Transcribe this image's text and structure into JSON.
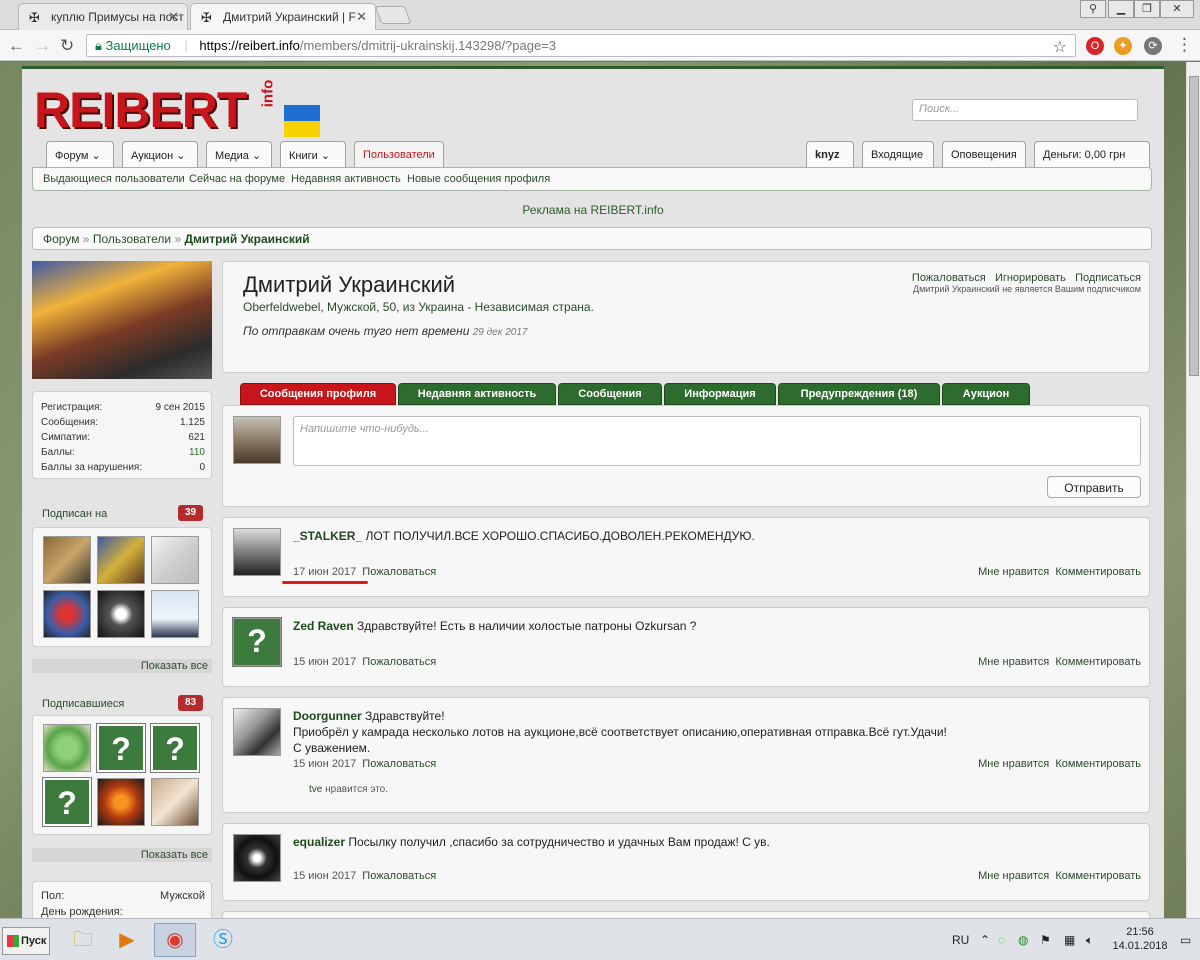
{
  "browser": {
    "tabs": [
      {
        "title": "куплю Примусы на пост"
      },
      {
        "title": "Дмитрий Украинский | F"
      }
    ],
    "secure_label": "Защищено",
    "url_host": "https://reibert.info",
    "url_path": "/members/dmitrij-ukrainskij.143298/?page=3"
  },
  "site": {
    "logo_text": "REIBERT",
    "logo_sub": "info",
    "search_placeholder": "Поиск...",
    "nav_left": [
      "Форум",
      "Аукцион",
      "Медиа",
      "Книги",
      "Пользователи"
    ],
    "nav_right": [
      "knyz",
      "Входящие",
      "Оповещения",
      "Деньги: 0,00 грн"
    ],
    "subnav": [
      "Выдающиеся пользователи",
      "Сейчас на форуме",
      "Недавняя активность",
      "Новые сообщения профиля"
    ],
    "ad_text": "Реклама на REIBERT.info",
    "breadcrumb": {
      "forum": "Форум",
      "users": "Пользователи",
      "current": "Дмитрий Украинский"
    }
  },
  "sidebar": {
    "stats": [
      {
        "label": "Регистрация:",
        "value": "9 сен 2015"
      },
      {
        "label": "Сообщения:",
        "value": "1.125"
      },
      {
        "label": "Симпатии:",
        "value": "621"
      },
      {
        "label": "Баллы:",
        "value": "110"
      },
      {
        "label": "Баллы за нарушения:",
        "value": "0"
      }
    ],
    "following": {
      "label": "Подписан на",
      "count": "39",
      "show_all": "Показать все"
    },
    "followers": {
      "label": "Подписавшиеся",
      "count": "83",
      "show_all": "Показать все"
    },
    "info": [
      {
        "label": "Пол:",
        "value": "Мужской"
      },
      {
        "label": "День рождения:",
        "value": ""
      }
    ]
  },
  "profile": {
    "name": "Дмитрий Украинский",
    "info_line": "Oberfeldwebel, Мужской, 50, из Украина - Независимая страна.",
    "status": "По отправкам очень туго нет времени",
    "status_date": "29 дек 2017",
    "actions": [
      "Пожаловаться",
      "Игнорировать",
      "Подписаться"
    ],
    "follow_note": "Дмитрий Украинский не является Вашим подписчиком",
    "tabs": [
      "Сообщения профиля",
      "Недавняя активность",
      "Сообщения",
      "Информация",
      "Предупреждения (18)",
      "Аукцион"
    ],
    "post_placeholder": "Напишите что-нибудь...",
    "send_label": "Отправить"
  },
  "messages": [
    {
      "author": "_STALKER_",
      "text": "ЛОТ ПОЛУЧИЛ.ВСЕ ХОРОШО.СПАСИБО.ДОВОЛЕН.РЕКОМЕНДУЮ.",
      "date": "17 июн 2017",
      "report": "Пожаловаться",
      "like": "Мне нравится",
      "comment": "Комментировать"
    },
    {
      "author": "Zed Raven",
      "text": "Здравствуйте! Есть в наличии холостые патроны Ozkursan ?",
      "date": "15 июн 2017",
      "report": "Пожаловаться",
      "like": "Мне нравится",
      "comment": "Комментировать"
    },
    {
      "author": "Doorgunner",
      "text": "Здравствуйте!",
      "text2": "Приобрёл у камрада несколько лотов на аукционе,всё соответствует описанию,оперативная отправка.Всё гут.Удачи!",
      "text3": "С уважением.",
      "date": "15 июн 2017",
      "report": "Пожаловаться",
      "like": "Мне нравится",
      "comment": "Комментировать",
      "likes_user": "tve",
      "likes_suffix": "нравится это."
    },
    {
      "author": "equalizer",
      "text": "Посылку получил ,спасибо за сотрудничество и удачных Вам продаж! С ув.",
      "date": "15 июн 2017",
      "report": "Пожаловаться",
      "like": "Мне нравится",
      "comment": "Комментировать"
    }
  ],
  "taskbar": {
    "start": "Пуск",
    "lang": "RU",
    "time": "21:56",
    "date": "14.01.2018"
  }
}
